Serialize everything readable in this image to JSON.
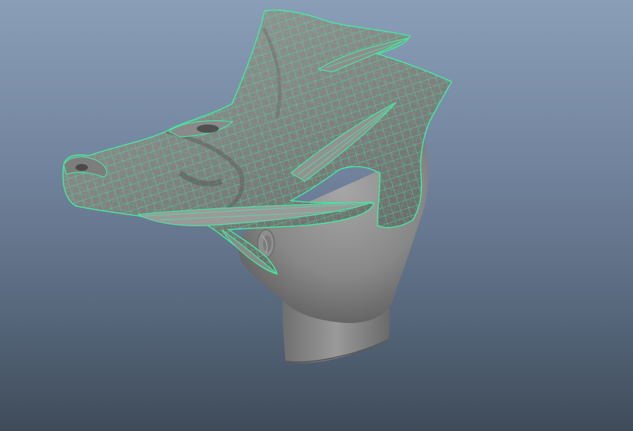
{
  "viewport": {
    "background_top": "#8a9eb8",
    "background_bottom": "#3f4b59"
  },
  "model": {
    "head_mesh_color": "#8c8c8c",
    "selected_mesh_color": "#858585",
    "wireframe_color": "#45e8a0",
    "selection_state": "helmet selected"
  }
}
